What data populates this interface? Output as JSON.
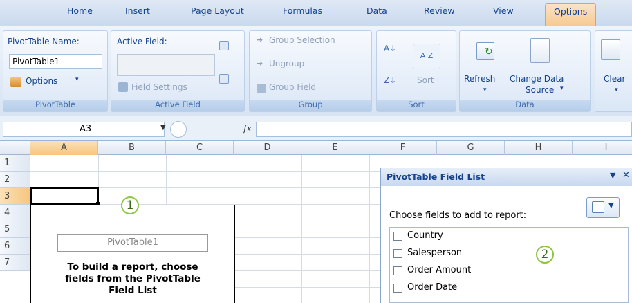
{
  "tabs": [
    "Home",
    "Insert",
    "Page Layout",
    "Formulas",
    "Data",
    "Review",
    "View",
    "Options"
  ],
  "groups": {
    "pivottable": {
      "name_label": "PivotTable Name:",
      "name_value": "PivotTable1",
      "options_label": "Options",
      "group_label": "PivotTable"
    },
    "active_field": {
      "label": "Active Field:",
      "value": "",
      "field_settings": "Field Settings",
      "group_label": "Active Field"
    },
    "group": {
      "group_selection": "Group Selection",
      "ungroup": "Ungroup",
      "group_field": "Group Field",
      "group_label": "Group"
    },
    "sort": {
      "sort_label": "Sort",
      "group_label": "Sort"
    },
    "data": {
      "refresh": "Refresh",
      "change_line1": "Change Data",
      "change_line2": "Source",
      "group_label": "Data"
    },
    "clear": {
      "label": "Clear"
    }
  },
  "formula_bar": {
    "name_box": "A3",
    "fx": "fx"
  },
  "columns": [
    "A",
    "B",
    "C",
    "D",
    "E",
    "F",
    "G",
    "H",
    "I"
  ],
  "rows": [
    "1",
    "2",
    "3",
    "4",
    "5",
    "6",
    "7"
  ],
  "placeholder": {
    "title": "PivotTable1",
    "line1": "To build a report, choose",
    "line2": "fields from the PivotTable",
    "line3": "Field List"
  },
  "callouts": [
    "1",
    "2"
  ],
  "field_list": {
    "title": "PivotTable Field List",
    "prompt": "Choose fields to add to report:",
    "fields": [
      "Country",
      "Salesperson",
      "Order Amount",
      "Order Date"
    ]
  },
  "colors": {
    "accent_tab": "#f6c98f",
    "ribbon": "#d7e4f4",
    "callout": "#8cc63f"
  }
}
